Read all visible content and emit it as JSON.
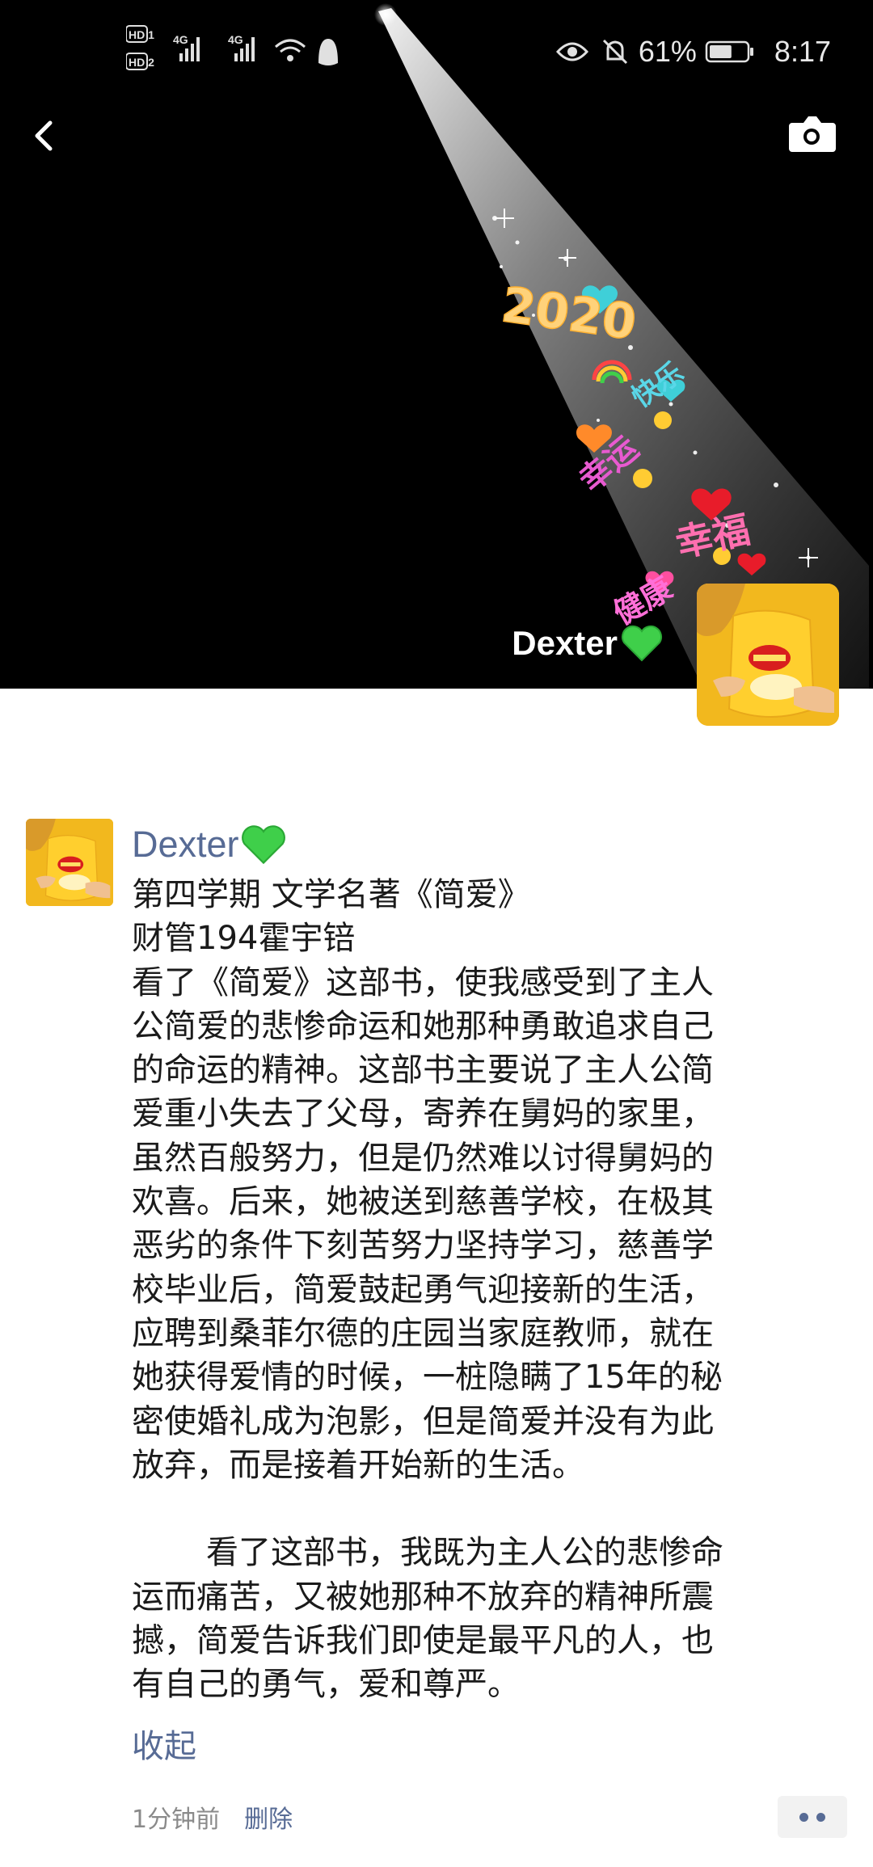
{
  "status_bar": {
    "signal_labels": [
      "HD 1",
      "HD 2",
      "4G",
      "4G"
    ],
    "icons": [
      "hd-icon",
      "signal-icon",
      "wifi-icon",
      "qq-icon",
      "eye-icon",
      "mute-icon",
      "battery-icon"
    ],
    "battery_percent": "61%",
    "battery_level": 0.61,
    "time": "8:17"
  },
  "header": {
    "back_icon": "back-chevron-icon",
    "camera_icon": "camera-icon"
  },
  "cover": {
    "title_2020": "2020",
    "stickers": [
      "快乐",
      "幸运",
      "幸福",
      "健康"
    ],
    "user_name": "Dexter",
    "name_emoji": "green-heart-icon"
  },
  "post": {
    "author": "Dexter",
    "author_emoji": "green-heart-icon",
    "lines": [
      "第四学期 文学名著《简爱》",
      "财管194霍宇锫",
      "看了《简爱》这部书，使我感受到了主人",
      "公简爱的悲惨命运和她那种勇敢追求自己",
      "的命运的精神。这部书主要说了主人公简",
      "爱重小失去了父母，寄养在舅妈的家里，",
      "虽然百般努力，但是仍然难以讨得舅妈的",
      "欢喜。后来，她被送到慈善学校，在极其",
      "恶劣的条件下刻苦努力坚持学习，慈善学",
      "校毕业后，简爱鼓起勇气迎接新的生活，",
      "应聘到桑菲尔德的庄园当家庭教师，就在",
      "她获得爱情的时候，一桩隐瞒了15年的秘",
      "密使婚礼成为泡影，但是简爱并没有为此",
      "放弃，而是接着开始新的生活。"
    ],
    "lines2": [
      "看了这部书，我既为主人公的悲惨命",
      "运而痛苦，又被她那种不放弃的精神所震",
      "撼，简爱告诉我们即使是最平凡的人，也",
      "有自己的勇气，爱和尊严。"
    ],
    "collapse_label": "收起",
    "timestamp": "1分钟前",
    "delete_label": "删除",
    "more_icon": "more-dots-icon"
  },
  "colors": {
    "link": "#576b95",
    "text": "#1a1a1a",
    "meta_gray": "#8a8a8a",
    "cover_bg": "#000000",
    "heart_green": "#3fcf4a"
  }
}
